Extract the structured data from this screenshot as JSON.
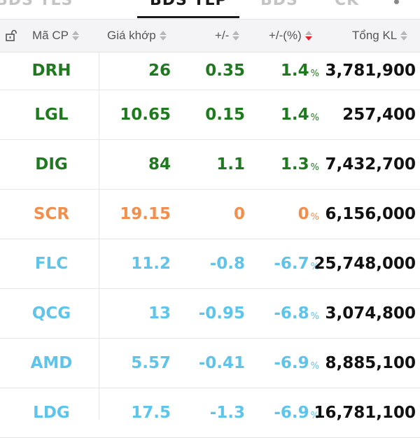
{
  "colors": {
    "up": "#1f7a1f",
    "reference": "#f08f4e",
    "down": "#5ec4ea",
    "volume": "#111111",
    "header_bg": "#f4f4f6",
    "sort_active": "#e0202a"
  },
  "tabs": [
    {
      "label": "BDS TLS",
      "active": false
    },
    {
      "label": "BDS TLP",
      "active": true
    },
    {
      "label": "BDS",
      "active": false
    },
    {
      "label": "CK",
      "active": false
    }
  ],
  "header": {
    "lock_icon": "unlock-icon",
    "symbol_label": "Mã CP",
    "price_label": "Giá khớp",
    "change_label": "+/-",
    "change_pct_label": "+/-(%)",
    "volume_label": "Tổng KL",
    "sorted_column": "change_pct",
    "sort_direction": "desc"
  },
  "rows": [
    {
      "symbol": "DRH",
      "price": "26",
      "change": "0.35",
      "change_pct": "1.4",
      "pct_unit": "%",
      "volume": "3,781,900",
      "trend": "up"
    },
    {
      "symbol": "LGL",
      "price": "10.65",
      "change": "0.15",
      "change_pct": "1.4",
      "pct_unit": "%",
      "volume": "257,400",
      "trend": "up"
    },
    {
      "symbol": "DIG",
      "price": "84",
      "change": "1.1",
      "change_pct": "1.3",
      "pct_unit": "%",
      "volume": "7,432,700",
      "trend": "up"
    },
    {
      "symbol": "SCR",
      "price": "19.15",
      "change": "0",
      "change_pct": "0",
      "pct_unit": "%",
      "volume": "6,156,000",
      "trend": "ref"
    },
    {
      "symbol": "FLC",
      "price": "11.2",
      "change": "-0.8",
      "change_pct": "-6.7",
      "pct_unit": "%",
      "volume": "25,748,000",
      "trend": "down"
    },
    {
      "symbol": "QCG",
      "price": "13",
      "change": "-0.95",
      "change_pct": "-6.8",
      "pct_unit": "%",
      "volume": "3,074,800",
      "trend": "down"
    },
    {
      "symbol": "AMD",
      "price": "5.57",
      "change": "-0.41",
      "change_pct": "-6.9",
      "pct_unit": "%",
      "volume": "8,885,100",
      "trend": "down"
    },
    {
      "symbol": "LDG",
      "price": "17.5",
      "change": "-1.3",
      "change_pct": "-6.9",
      "pct_unit": "%",
      "volume": "16,781,100",
      "trend": "down"
    }
  ]
}
